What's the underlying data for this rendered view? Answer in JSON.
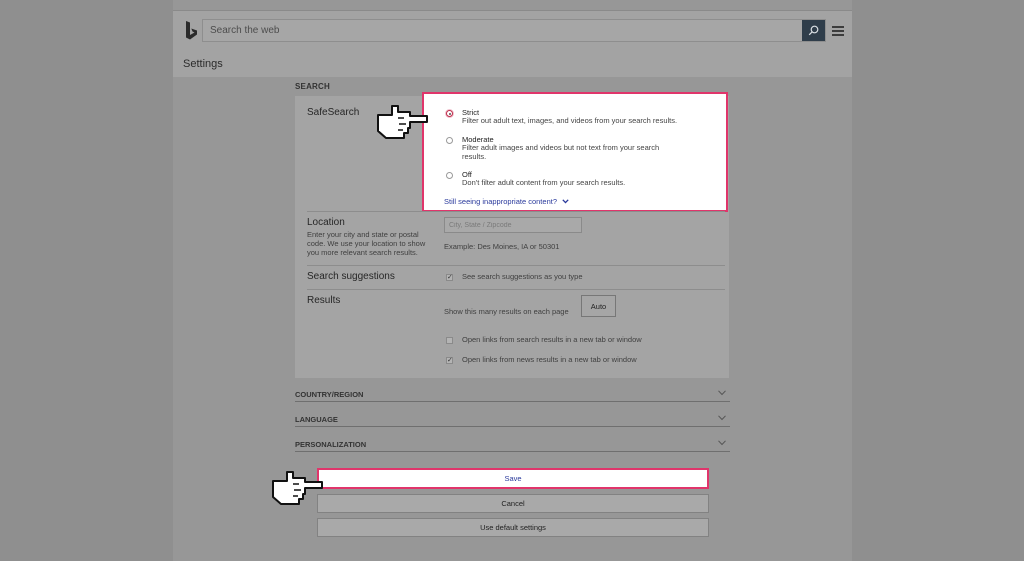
{
  "header": {
    "search_placeholder": "Search the web",
    "page_title": "Settings"
  },
  "search_section": {
    "heading": "SEARCH",
    "safesearch": {
      "label": "SafeSearch",
      "options": [
        {
          "title": "Strict",
          "desc": "Filter out adult text, images, and videos from your search results.",
          "checked": true
        },
        {
          "title": "Moderate",
          "desc_line1": "Filter adult images and videos but not text from your search",
          "desc_line2": "results.",
          "checked": false
        },
        {
          "title": "Off",
          "desc": "Don't filter adult content from your search results.",
          "checked": false
        }
      ],
      "link": "Still seeing inappropriate content?"
    },
    "location": {
      "label": "Location",
      "help_line1": "Enter your city and state or postal",
      "help_line2": "code. We use your location to show",
      "help_line3": "you more relevant search results.",
      "placeholder": "City, State / Zipcode",
      "example": "Example: Des Moines, IA or 50301"
    },
    "suggestions": {
      "label": "Search suggestions",
      "checkbox_label": "See search suggestions as you type",
      "checked": true
    },
    "results": {
      "label": "Results",
      "count_label": "Show this many results on each page",
      "count_value": "Auto",
      "new_tab_search": "Open links from search results in a new tab or window",
      "new_tab_search_checked": false,
      "new_tab_news": "Open links from news results in a new tab or window",
      "new_tab_news_checked": true
    }
  },
  "accordions": [
    "COUNTRY/REGION",
    "LANGUAGE",
    "PERSONALIZATION"
  ],
  "buttons": {
    "save": "Save",
    "cancel": "Cancel",
    "defaults": "Use default settings"
  },
  "colors": {
    "highlight": "#e0356b",
    "link": "#2a3a9c",
    "search_button": "#2f3d4a"
  }
}
